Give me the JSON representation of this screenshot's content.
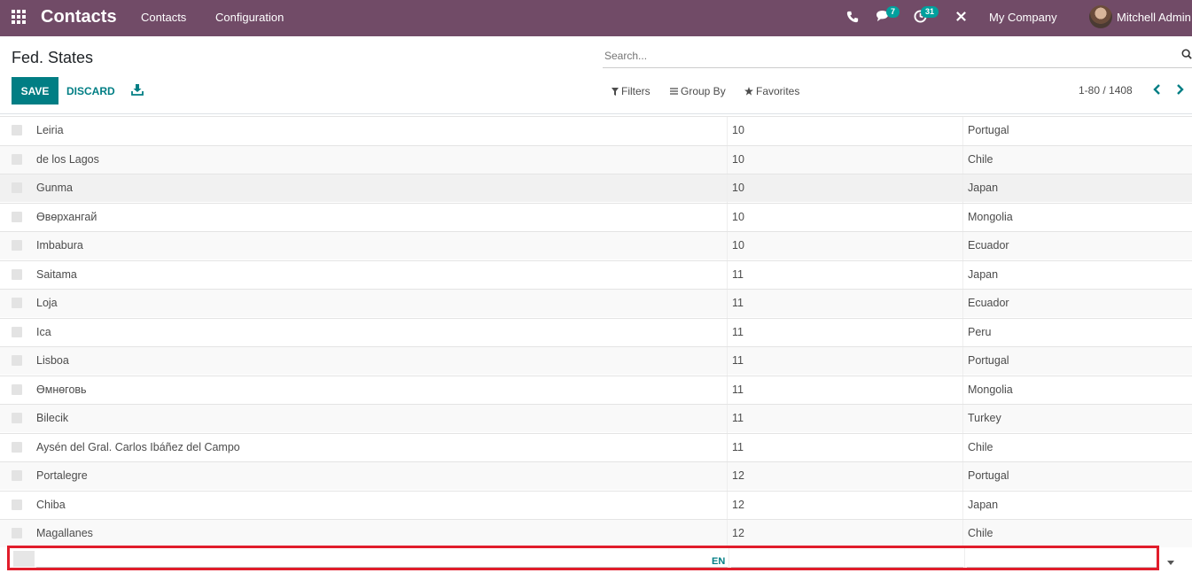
{
  "navbar": {
    "brand": "Contacts",
    "menu": [
      "Contacts",
      "Configuration"
    ],
    "messages_count": "7",
    "activities_count": "31",
    "company": "My Company",
    "user": "Mitchell Admin",
    "bg_color": "#714b67"
  },
  "control_panel": {
    "title": "Fed. States",
    "search_placeholder": "Search...",
    "save_label": "SAVE",
    "discard_label": "DISCARD",
    "filters_label": "Filters",
    "group_by_label": "Group By",
    "favorites_label": "Favorites",
    "pager": "1-80 / 1408",
    "accent_color": "#017e84"
  },
  "rows": [
    {
      "name": "Leiria",
      "code": "10",
      "country": "Portugal"
    },
    {
      "name": "de los Lagos",
      "code": "10",
      "country": "Chile"
    },
    {
      "name": "Gunma",
      "code": "10",
      "country": "Japan"
    },
    {
      "name": "Өвөрхангай",
      "code": "10",
      "country": "Mongolia"
    },
    {
      "name": "Imbabura",
      "code": "10",
      "country": "Ecuador"
    },
    {
      "name": "Saitama",
      "code": "11",
      "country": "Japan"
    },
    {
      "name": "Loja",
      "code": "11",
      "country": "Ecuador"
    },
    {
      "name": "Ica",
      "code": "11",
      "country": "Peru"
    },
    {
      "name": "Lisboa",
      "code": "11",
      "country": "Portugal"
    },
    {
      "name": "Өмнөговь",
      "code": "11",
      "country": "Mongolia"
    },
    {
      "name": "Bilecik",
      "code": "11",
      "country": "Turkey"
    },
    {
      "name": "Aysén del Gral. Carlos Ibáñez del Campo",
      "code": "11",
      "country": "Chile"
    },
    {
      "name": "Portalegre",
      "code": "12",
      "country": "Portugal"
    },
    {
      "name": "Chiba",
      "code": "12",
      "country": "Japan"
    },
    {
      "name": "Magallanes",
      "code": "12",
      "country": "Chile"
    }
  ],
  "new_row": {
    "lang_tag": "EN",
    "highlight_color": "#e11d2b"
  }
}
